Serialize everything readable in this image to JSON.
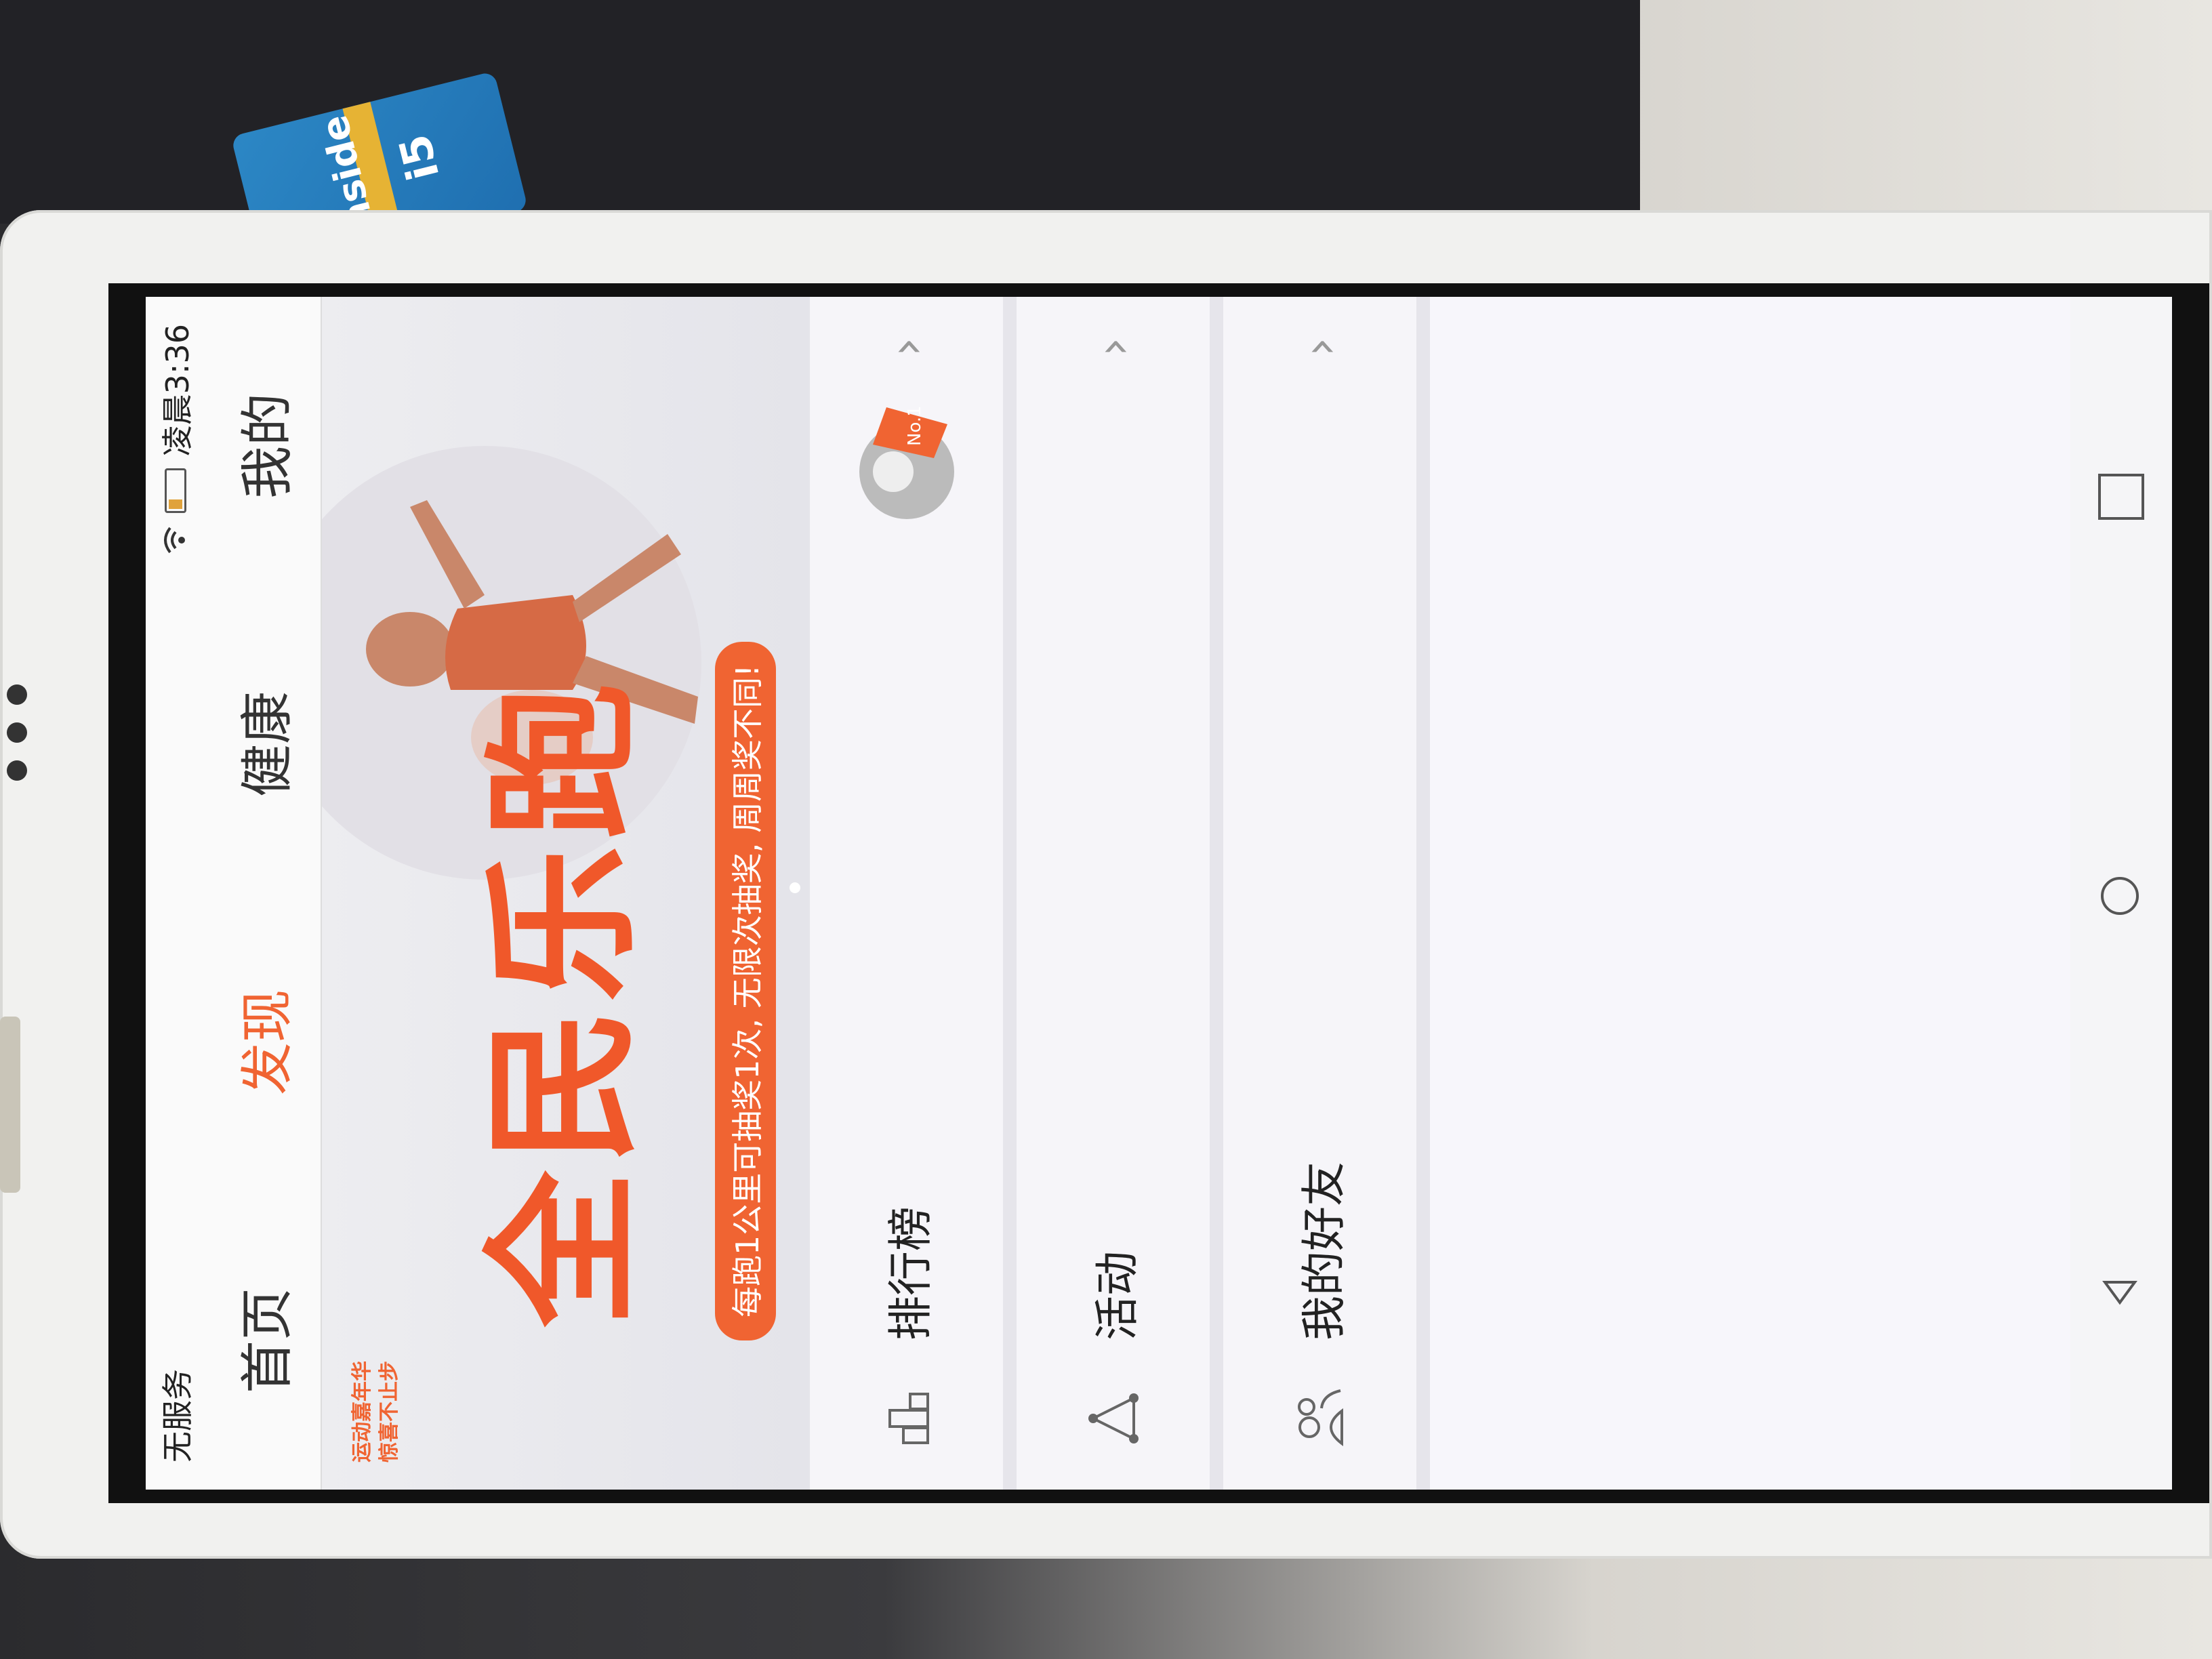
{
  "status": {
    "carrier": "无服务",
    "time": "凌晨3:36"
  },
  "tabs": [
    {
      "label": "首页"
    },
    {
      "label": "发现"
    },
    {
      "label": "健康"
    },
    {
      "label": "我的"
    }
  ],
  "banner": {
    "logo_line1": "运动嘉年华",
    "logo_line2": "惊喜不止步",
    "title": "全民乐跑",
    "subtitle": "每跑1公里可抽奖1次, 无限次抽奖, 周周奖不同!"
  },
  "list": [
    {
      "label": "排行榜",
      "icon": "podium-icon",
      "badge": "No.1"
    },
    {
      "label": "活动",
      "icon": "triangle-nodes-icon"
    },
    {
      "label": "我的好友",
      "icon": "friends-icon"
    }
  ],
  "sticker": {
    "text": "inside",
    "text2": "i5"
  },
  "colors": {
    "accent": "#f06432"
  }
}
